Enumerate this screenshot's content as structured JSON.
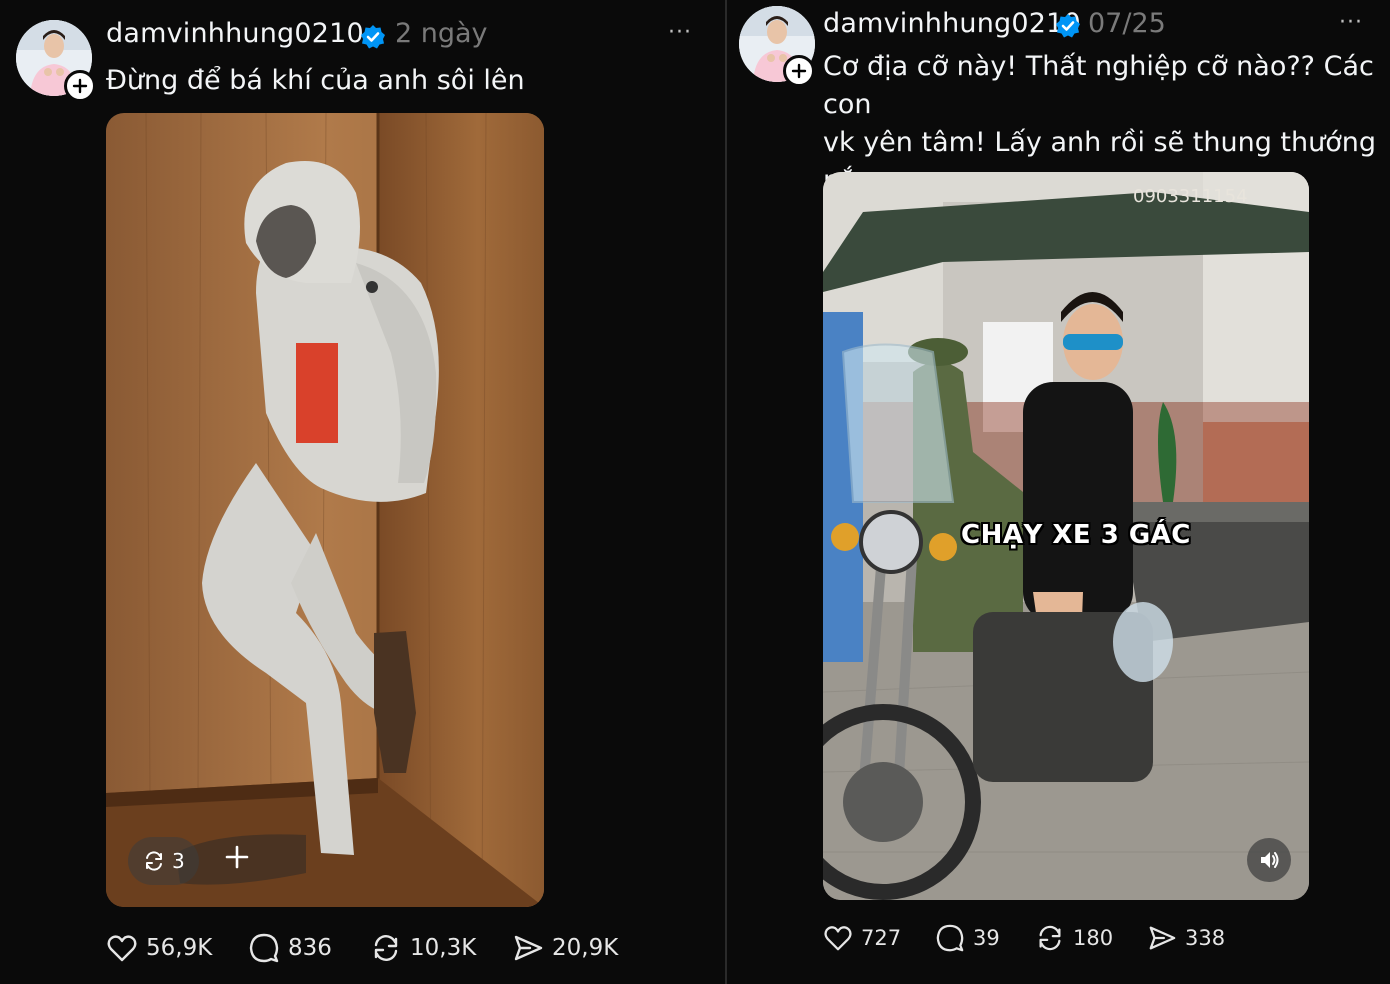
{
  "posts": [
    {
      "username": "damvinhhung0210",
      "time": "2 ngày",
      "more": "···",
      "caption": "Đừng để bá khí của anh sôi lên",
      "media": {
        "repost_count": "3"
      },
      "actions": {
        "likes": "56,9K",
        "comments": "836",
        "reposts": "10,3K",
        "shares": "20,9K"
      }
    },
    {
      "username": "damvinhhung0210",
      "time": "07/25",
      "more": "···",
      "caption_lines": [
        "Cơ địa cỡ này! Thất nghiệp cỡ nào?? Các con",
        "vk yên tâm! Lấy anh rồi sẽ thung thướng nắm",
        "ý"
      ],
      "media": {
        "overlay_text": "CHẠY XE 3 GÁC",
        "sign_text": "0903311154"
      },
      "actions": {
        "likes": "727",
        "comments": "39",
        "reposts": "180",
        "shares": "338"
      }
    }
  ],
  "colors": {
    "background": "#0a0a0a",
    "verified": "#0095f6",
    "muted": "#7a7a7a"
  },
  "icons": [
    "heart-icon",
    "comment-icon",
    "repost-icon",
    "share-icon",
    "verified-icon",
    "plus-icon",
    "sound-icon"
  ]
}
